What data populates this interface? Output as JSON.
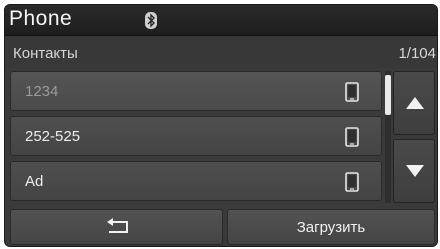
{
  "header": {
    "title": "Phone",
    "bluetooth_icon": "bluetooth-icon"
  },
  "subheader": {
    "section_label": "Контакты",
    "page_counter": "1/104"
  },
  "contacts": [
    {
      "label": "1234",
      "icon": "mobile-phone-icon",
      "selected": true
    },
    {
      "label": "252-525",
      "icon": "mobile-phone-icon",
      "selected": false
    },
    {
      "label": "Ad",
      "icon": "mobile-phone-icon",
      "selected": false
    }
  ],
  "scroll": {
    "up_icon": "triangle-up-icon",
    "down_icon": "triangle-down-icon"
  },
  "footer": {
    "back_icon": "back-arrow-icon",
    "download_label": "Загрузить"
  },
  "colors": {
    "background": "#3a3a3a",
    "row": "#4a4a4a",
    "text": "#ececec",
    "dim_text": "#9a9a9a"
  }
}
